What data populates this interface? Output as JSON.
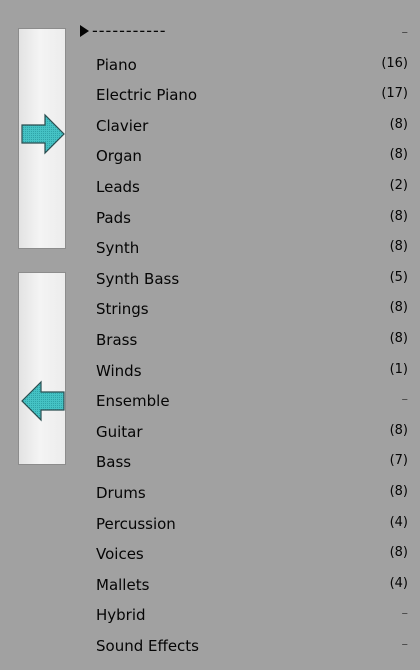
{
  "buttons": {
    "add_icon": "right-arrow-icon",
    "remove_icon": "left-arrow-icon",
    "arrow_color": "#45c2c4"
  },
  "list": {
    "header": {
      "label": "-----------",
      "count": "–"
    },
    "items": [
      {
        "label": "Piano",
        "count": "(16)"
      },
      {
        "label": "Electric Piano",
        "count": "(17)"
      },
      {
        "label": "Clavier",
        "count": "(8)"
      },
      {
        "label": "Organ",
        "count": "(8)"
      },
      {
        "label": "Leads",
        "count": "(2)"
      },
      {
        "label": "Pads",
        "count": "(8)"
      },
      {
        "label": "Synth",
        "count": "(8)"
      },
      {
        "label": "Synth Bass",
        "count": "(5)"
      },
      {
        "label": "Strings",
        "count": "(8)"
      },
      {
        "label": "Brass",
        "count": "(8)"
      },
      {
        "label": "Winds",
        "count": "(1)"
      },
      {
        "label": "Ensemble",
        "count": "–"
      },
      {
        "label": "Guitar",
        "count": "(8)"
      },
      {
        "label": "Bass",
        "count": "(7)"
      },
      {
        "label": "Drums",
        "count": "(8)"
      },
      {
        "label": "Percussion",
        "count": "(4)"
      },
      {
        "label": "Voices",
        "count": "(8)"
      },
      {
        "label": "Mallets",
        "count": "(4)"
      },
      {
        "label": "Hybrid",
        "count": "–"
      },
      {
        "label": "Sound Effects",
        "count": "–"
      }
    ]
  }
}
